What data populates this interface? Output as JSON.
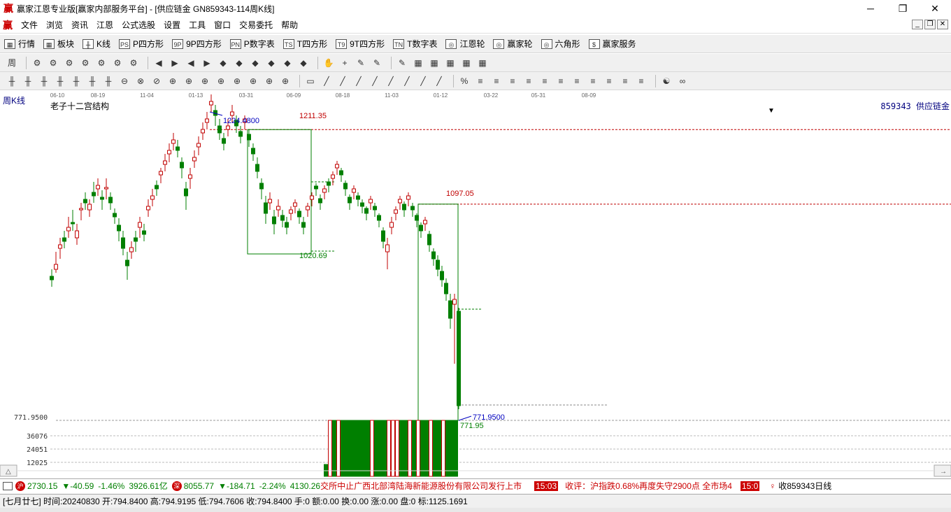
{
  "window": {
    "title": "赢家江恩专业版[赢家内部服务平台] - [供应链金  GN859343-114周K线]",
    "controls": [
      "─",
      "❐",
      "✕"
    ]
  },
  "menu": [
    "文件",
    "浏览",
    "资讯",
    "江恩",
    "公式选股",
    "设置",
    "工具",
    "窗口",
    "交易委托",
    "帮助"
  ],
  "nav": [
    {
      "icon": "quote-table-icon",
      "glyph": "▦",
      "label": "行情"
    },
    {
      "icon": "sector-icon",
      "glyph": "▦",
      "label": "板块"
    },
    {
      "icon": "kline-icon",
      "glyph": "╫",
      "label": "K线"
    },
    {
      "icon": "p-square-icon",
      "glyph": "PS",
      "label": "P四方形"
    },
    {
      "icon": "9p-square-icon",
      "glyph": "9P",
      "label": "9P四方形"
    },
    {
      "icon": "p-number-table-icon",
      "glyph": "PN",
      "label": "P数字表"
    },
    {
      "icon": "t-square-icon",
      "glyph": "TS",
      "label": "T四方形"
    },
    {
      "icon": "9t-square-icon",
      "glyph": "T9",
      "label": "9T四方形"
    },
    {
      "icon": "t-number-table-icon",
      "glyph": "TN",
      "label": "T数字表"
    },
    {
      "icon": "gann-wheel-icon",
      "glyph": "◎",
      "label": "江恩轮"
    },
    {
      "icon": "winner-wheel-icon",
      "glyph": "◎",
      "label": "赢家轮"
    },
    {
      "icon": "hexagon-icon",
      "glyph": "◎",
      "label": "六角形"
    },
    {
      "icon": "dollar-icon",
      "glyph": "$",
      "label": "赢家服务"
    }
  ],
  "toolbar1": [
    "周",
    "⚙",
    "⚙",
    "⚙",
    "⚙",
    "⚙",
    "⚙",
    "⚙",
    "◀",
    "▶",
    "◀",
    "▶",
    "◆",
    "◆",
    "◆",
    "◆",
    "◆",
    "◆",
    "✋",
    "+",
    "✎",
    "✎",
    "✎",
    "▦",
    "▦",
    "▦",
    "▦",
    "▦"
  ],
  "toolbar2": [
    "╫",
    "╫",
    "╫",
    "╫",
    "╫",
    "╫",
    "╫",
    "⊖",
    "⊗",
    "⊘",
    "⊕",
    "⊕",
    "⊕",
    "⊕",
    "⊕",
    "⊕",
    "⊕",
    "⊕",
    "▭",
    "╱",
    "╱",
    "╱",
    "╱",
    "╱",
    "╱",
    "╱",
    "╱",
    "%",
    "≡",
    "≡",
    "≡",
    "≡",
    "≡",
    "≡",
    "≡",
    "≡",
    "≡",
    "≡",
    "≡",
    "☯",
    "∞"
  ],
  "chart": {
    "period_label": "周K线",
    "study_name": "老子十二宫结构",
    "symbol_label": "859343 供应链金",
    "dates": [
      "06-10",
      "08-19",
      "11-04",
      "01-13",
      "03-31",
      "06-09",
      "08-18",
      "11-03",
      "01-12",
      "03-22",
      "05-31",
      "08-09"
    ],
    "price_labels": {
      "high_marker": "1224.4800",
      "box1_top": "1211.35",
      "box1_bottom": "1020.69",
      "box2_top": "1097.05",
      "low_marker": "771.9500",
      "low_green": "771.95",
      "axis_low": "771.9500"
    },
    "volume_axis": [
      "36076",
      "24051",
      "12025"
    ],
    "colors": {
      "up": "#c00000",
      "down": "#007f00",
      "marker": "#0000c0",
      "level": "#c00000"
    }
  },
  "chart_data": {
    "type": "candlestick",
    "title": "老子十二宫结构",
    "x_ticks": [
      "06-10",
      "08-19",
      "11-04",
      "01-13",
      "03-31",
      "06-09",
      "08-18",
      "11-03",
      "01-12",
      "03-22",
      "05-31",
      "08-09"
    ],
    "levels": [
      1224.48,
      1211.35,
      1097.05,
      1020.69,
      771.95
    ],
    "volume_ticks": [
      36076,
      24051,
      12025
    ],
    "last_bar": {
      "open": 794.84,
      "high": 794.9195,
      "low": 794.7606,
      "close": 794.84
    }
  },
  "ticker": {
    "sh_index": "2730.15",
    "sh_change": "▼-40.59",
    "sh_pct": "-1.46%",
    "sh_amount": "3926.61亿",
    "sz_index": "8055.77",
    "sz_change": "▼-184.71",
    "sz_pct": "-2.24%",
    "sz_amount": "4130.26",
    "news1": "交所中止广西北部湾陆海新能源股份有限公司发行上市",
    "time1": "15:03",
    "news2": "收评：沪指跌0.68%再度失守2900点 全市场4",
    "time2": "15:0",
    "right_label": "收859343日线"
  },
  "status": {
    "text": "[七月廿七] 时间:20240830 开:794.8400 高:794.9195 低:794.7606 收:794.8400 手:0 额:0.00 换:0.00 涨:0.00 盘:0 标:1125.1691"
  }
}
